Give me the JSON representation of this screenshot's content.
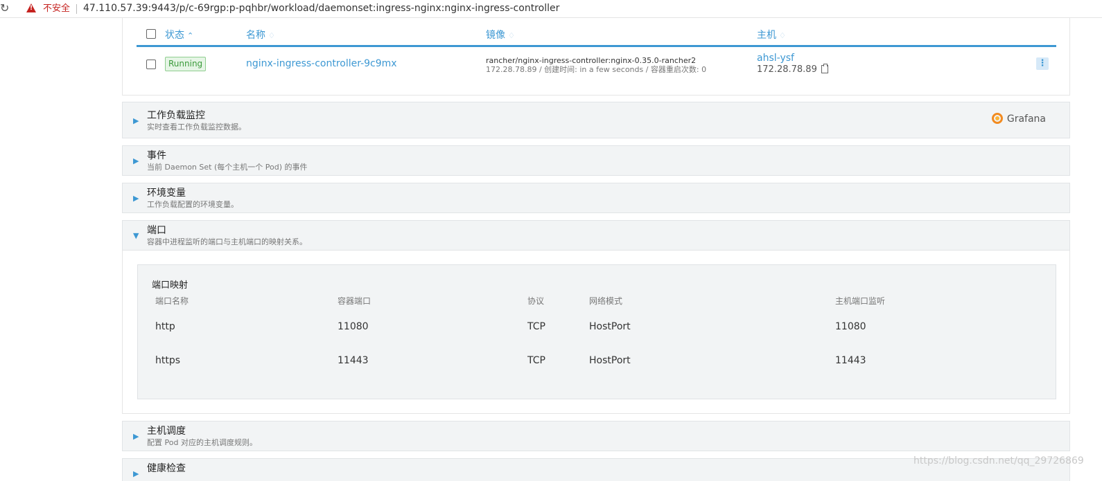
{
  "browser": {
    "security_label": "不安全",
    "url": "47.110.57.39:9443/p/c-69rgp:p-pqhbr/workload/daemonset:ingress-nginx:nginx-ingress-controller"
  },
  "pods": {
    "columns": {
      "state": "状态",
      "name": "名称",
      "image": "镜像",
      "host": "主机"
    },
    "rows": [
      {
        "state": "Running",
        "name": "nginx-ingress-controller-9c9mx",
        "image": "rancher/nginx-ingress-controller:nginx-0.35.0-rancher2",
        "image_detail": "172.28.78.89 / 创建时间: in a few seconds / 容器重启次数: 0",
        "host_name": "ahsl-ysf",
        "host_ip": "172.28.78.89"
      }
    ]
  },
  "sections": {
    "monitoring": {
      "title": "工作负载监控",
      "desc": "实时查看工作负载监控数据。",
      "grafana_label": "Grafana"
    },
    "events": {
      "title": "事件",
      "desc": "当前 Daemon Set (每个主机一个 Pod) 的事件"
    },
    "env": {
      "title": "环境变量",
      "desc": "工作负载配置的环境变量。"
    },
    "ports": {
      "title": "端口",
      "desc": "容器中进程监听的端口与主机端口的映射关系。",
      "mapping_title": "端口映射",
      "columns": [
        "端口名称",
        "容器端口",
        "协议",
        "网络模式",
        "主机端口监听"
      ],
      "rows": [
        [
          "http",
          "11080",
          "TCP",
          "HostPort",
          "11080"
        ],
        [
          "https",
          "11443",
          "TCP",
          "HostPort",
          "11443"
        ]
      ]
    },
    "scheduling": {
      "title": "主机调度",
      "desc": "配置 Pod 对应的主机调度规则。"
    },
    "health": {
      "title": "健康检查"
    }
  },
  "watermark": "https://blog.csdn.net/qq_29726869",
  "colors": {
    "accent": "#3d98d3",
    "running": "#3a9a3a",
    "danger": "#c5221f"
  }
}
